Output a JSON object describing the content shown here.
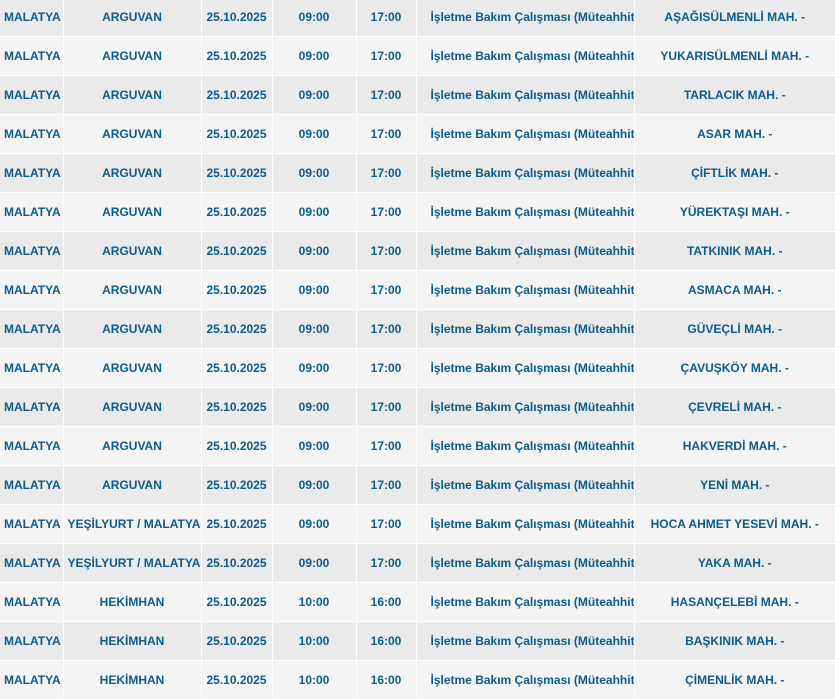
{
  "rows": [
    {
      "city": "MALATYA",
      "district": "ARGUVAN",
      "date": "25.10.2025",
      "start": "09:00",
      "end": "17:00",
      "reason": "İşletme Bakım Çalışması (Müteahhit)",
      "area": "AŞAĞISÜLMENLİ MAH. -"
    },
    {
      "city": "MALATYA",
      "district": "ARGUVAN",
      "date": "25.10.2025",
      "start": "09:00",
      "end": "17:00",
      "reason": "İşletme Bakım Çalışması (Müteahhit)",
      "area": "YUKARISÜLMENLİ MAH. -"
    },
    {
      "city": "MALATYA",
      "district": "ARGUVAN",
      "date": "25.10.2025",
      "start": "09:00",
      "end": "17:00",
      "reason": "İşletme Bakım Çalışması (Müteahhit)",
      "area": "TARLACIK MAH. -"
    },
    {
      "city": "MALATYA",
      "district": "ARGUVAN",
      "date": "25.10.2025",
      "start": "09:00",
      "end": "17:00",
      "reason": "İşletme Bakım Çalışması (Müteahhit)",
      "area": "ASAR MAH. -"
    },
    {
      "city": "MALATYA",
      "district": "ARGUVAN",
      "date": "25.10.2025",
      "start": "09:00",
      "end": "17:00",
      "reason": "İşletme Bakım Çalışması (Müteahhit)",
      "area": "ÇİFTLİK MAH. -"
    },
    {
      "city": "MALATYA",
      "district": "ARGUVAN",
      "date": "25.10.2025",
      "start": "09:00",
      "end": "17:00",
      "reason": "İşletme Bakım Çalışması (Müteahhit)",
      "area": "YÜREKTAŞI MAH. -"
    },
    {
      "city": "MALATYA",
      "district": "ARGUVAN",
      "date": "25.10.2025",
      "start": "09:00",
      "end": "17:00",
      "reason": "İşletme Bakım Çalışması (Müteahhit)",
      "area": "TATKINIK MAH. -"
    },
    {
      "city": "MALATYA",
      "district": "ARGUVAN",
      "date": "25.10.2025",
      "start": "09:00",
      "end": "17:00",
      "reason": "İşletme Bakım Çalışması (Müteahhit)",
      "area": "ASMACA MAH. -"
    },
    {
      "city": "MALATYA",
      "district": "ARGUVAN",
      "date": "25.10.2025",
      "start": "09:00",
      "end": "17:00",
      "reason": "İşletme Bakım Çalışması (Müteahhit)",
      "area": "GÜVEÇLİ MAH. -"
    },
    {
      "city": "MALATYA",
      "district": "ARGUVAN",
      "date": "25.10.2025",
      "start": "09:00",
      "end": "17:00",
      "reason": "İşletme Bakım Çalışması (Müteahhit)",
      "area": "ÇAVUŞKÖY MAH. -"
    },
    {
      "city": "MALATYA",
      "district": "ARGUVAN",
      "date": "25.10.2025",
      "start": "09:00",
      "end": "17:00",
      "reason": "İşletme Bakım Çalışması (Müteahhit)",
      "area": "ÇEVRELİ MAH. -"
    },
    {
      "city": "MALATYA",
      "district": "ARGUVAN",
      "date": "25.10.2025",
      "start": "09:00",
      "end": "17:00",
      "reason": "İşletme Bakım Çalışması (Müteahhit)",
      "area": "HAKVERDİ MAH. -"
    },
    {
      "city": "MALATYA",
      "district": "ARGUVAN",
      "date": "25.10.2025",
      "start": "09:00",
      "end": "17:00",
      "reason": "İşletme Bakım Çalışması (Müteahhit)",
      "area": "YENİ MAH. -"
    },
    {
      "city": "MALATYA",
      "district": "YEŞİLYURT / MALATYA",
      "date": "25.10.2025",
      "start": "09:00",
      "end": "17:00",
      "reason": "İşletme Bakım Çalışması (Müteahhit)",
      "area": "HOCA AHMET YESEVİ MAH. -"
    },
    {
      "city": "MALATYA",
      "district": "YEŞİLYURT / MALATYA",
      "date": "25.10.2025",
      "start": "09:00",
      "end": "17:00",
      "reason": "İşletme Bakım Çalışması (Müteahhit)",
      "area": "YAKA MAH. -"
    },
    {
      "city": "MALATYA",
      "district": "HEKİMHAN",
      "date": "25.10.2025",
      "start": "10:00",
      "end": "16:00",
      "reason": "İşletme Bakım Çalışması (Müteahhit)",
      "area": "HASANÇELEBİ MAH. -"
    },
    {
      "city": "MALATYA",
      "district": "HEKİMHAN",
      "date": "25.10.2025",
      "start": "10:00",
      "end": "16:00",
      "reason": "İşletme Bakım Çalışması (Müteahhit)",
      "area": "BAŞKINIK MAH. -"
    },
    {
      "city": "MALATYA",
      "district": "HEKİMHAN",
      "date": "25.10.2025",
      "start": "10:00",
      "end": "16:00",
      "reason": "İşletme Bakım Çalışması (Müteahhit)",
      "area": "ÇİMENLİK MAH. -"
    }
  ]
}
